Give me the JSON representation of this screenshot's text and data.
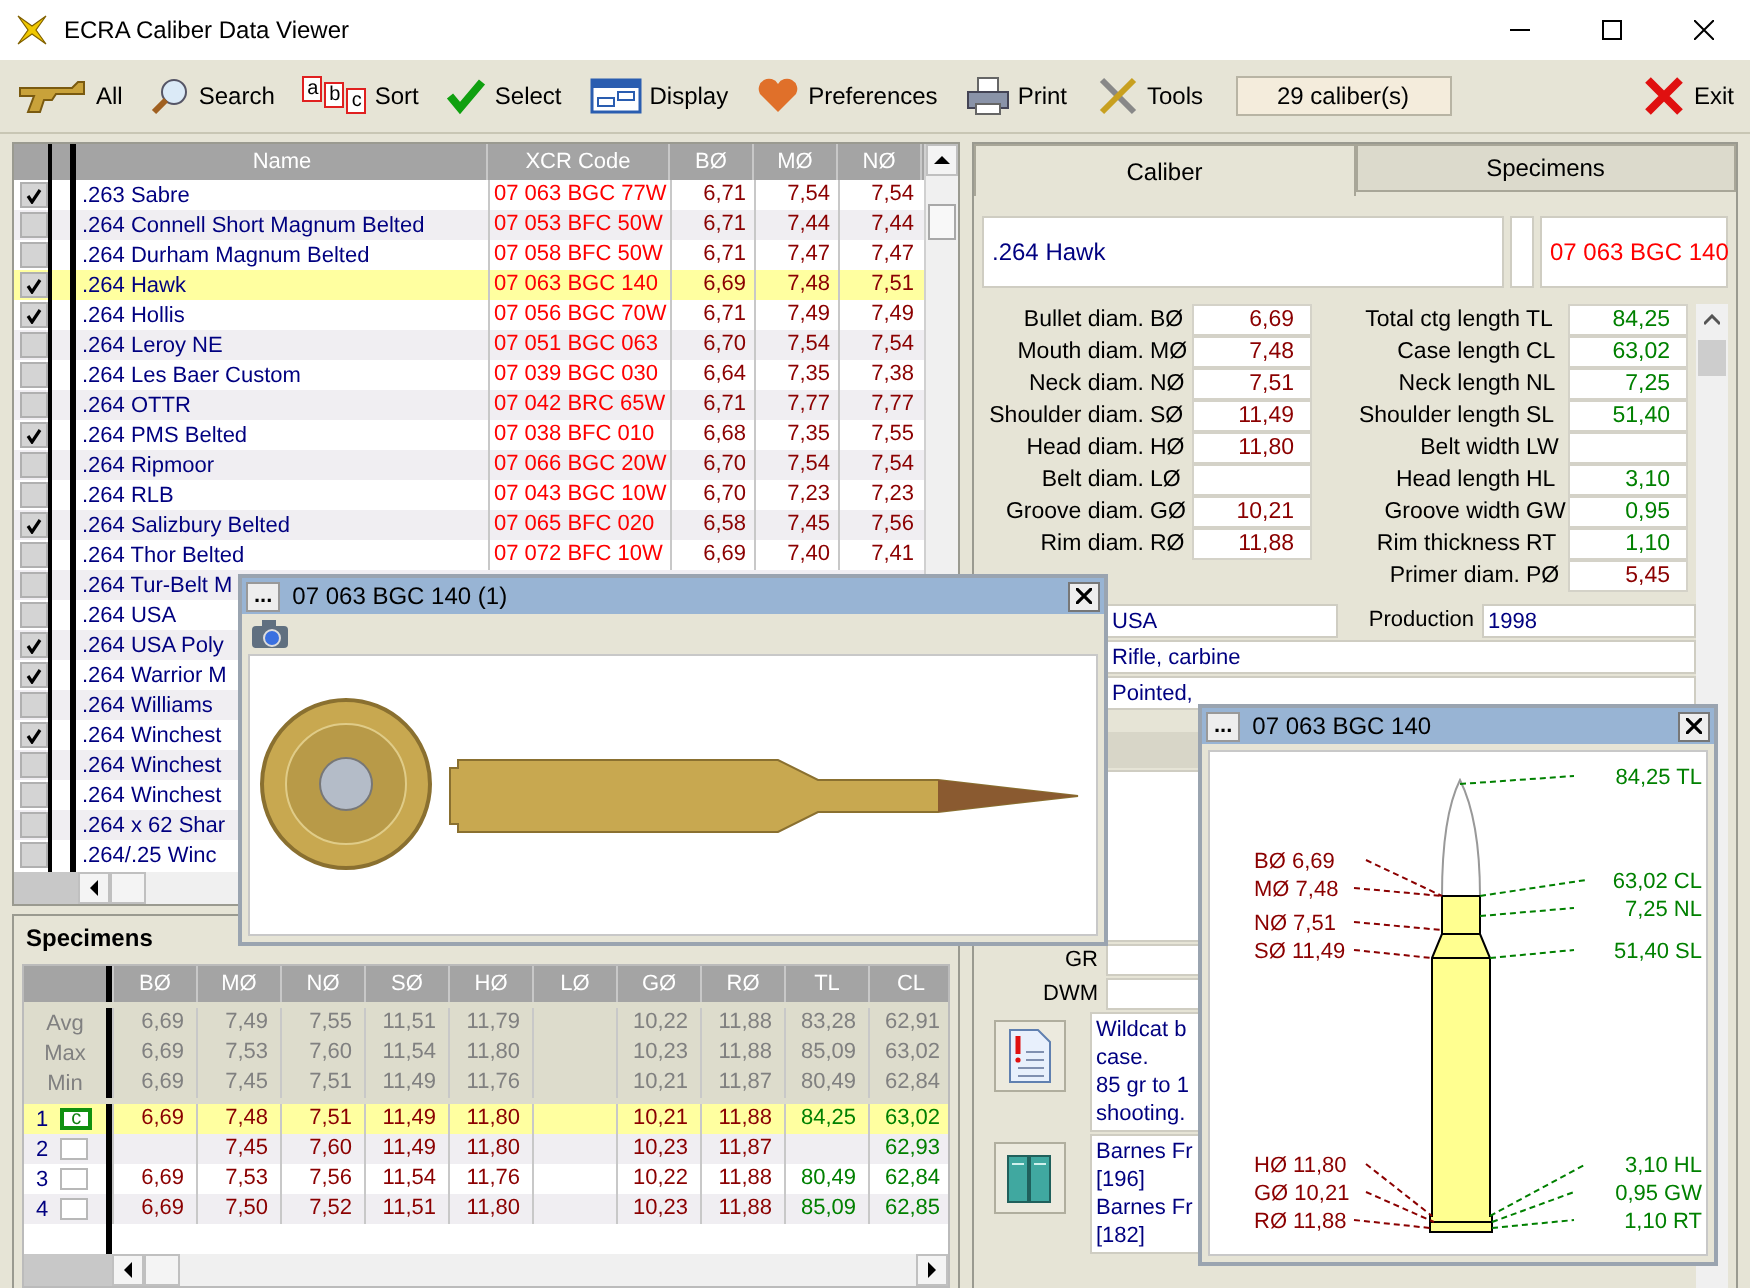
{
  "window": {
    "title": "ECRA Caliber Data Viewer"
  },
  "toolbar": {
    "buttons": [
      {
        "label": "All",
        "kind": "all"
      },
      {
        "label": "Search",
        "kind": "search"
      },
      {
        "label": "Sort",
        "kind": "sort",
        "icon_letters": [
          "a",
          "b",
          "c"
        ]
      },
      {
        "label": "Select",
        "kind": "select"
      },
      {
        "label": "Display",
        "kind": "display"
      },
      {
        "label": "Preferences",
        "kind": "preferences"
      },
      {
        "label": "Print",
        "kind": "print"
      },
      {
        "label": "Tools",
        "kind": "tools"
      }
    ],
    "counter": "29 caliber(s)",
    "exit_button": {
      "label": "Exit"
    }
  },
  "caliber_table": {
    "columns": [
      "Name",
      "XCR Code",
      "BØ",
      "MØ",
      "NØ"
    ],
    "rows": [
      {
        "checked": true,
        "selected": false,
        "cells": [
          ".263 Sabre",
          "07 063 BGC 77W",
          "6,71",
          "7,54",
          "7,54"
        ]
      },
      {
        "checked": false,
        "selected": false,
        "cells": [
          ".264 Connell Short Magnum Belted",
          "07 053 BFC 50W",
          "6,71",
          "7,44",
          "7,44"
        ]
      },
      {
        "checked": false,
        "selected": false,
        "cells": [
          ".264 Durham Magnum Belted",
          "07 058 BFC 50W",
          "6,71",
          "7,47",
          "7,47"
        ]
      },
      {
        "checked": true,
        "selected": true,
        "cells": [
          ".264 Hawk",
          "07 063 BGC 140",
          "6,69",
          "7,48",
          "7,51"
        ]
      },
      {
        "checked": true,
        "selected": false,
        "cells": [
          ".264 Hollis",
          "07 056 BGC 70W",
          "6,71",
          "7,49",
          "7,49"
        ]
      },
      {
        "checked": false,
        "selected": false,
        "cells": [
          ".264 Leroy NE",
          "07 051 BGC 063",
          "6,70",
          "7,54",
          "7,54"
        ]
      },
      {
        "checked": false,
        "selected": false,
        "cells": [
          ".264 Les Baer Custom",
          "07 039 BGC 030",
          "6,64",
          "7,35",
          "7,38"
        ]
      },
      {
        "checked": false,
        "selected": false,
        "cells": [
          ".264 OTTR",
          "07 042 BRC 65W",
          "6,71",
          "7,77",
          "7,77"
        ]
      },
      {
        "checked": true,
        "selected": false,
        "cells": [
          ".264 PMS Belted",
          "07 038 BFC 010",
          "6,68",
          "7,35",
          "7,55"
        ]
      },
      {
        "checked": false,
        "selected": false,
        "cells": [
          ".264 Ripmoor",
          "07 066 BGC 20W",
          "6,70",
          "7,54",
          "7,54"
        ]
      },
      {
        "checked": false,
        "selected": false,
        "cells": [
          ".264 RLB",
          "07 043 BGC 10W",
          "6,70",
          "7,23",
          "7,23"
        ]
      },
      {
        "checked": true,
        "selected": false,
        "cells": [
          ".264 Salizbury Belted",
          "07 065 BFC 020",
          "6,58",
          "7,45",
          "7,56"
        ]
      },
      {
        "checked": false,
        "selected": false,
        "cells": [
          ".264 Thor Belted",
          "07 072 BFC 10W",
          "6,69",
          "7,40",
          "7,41"
        ]
      },
      {
        "checked": false,
        "selected": false,
        "cells": [
          ".264 Tur-Belt M"
        ]
      },
      {
        "checked": false,
        "selected": false,
        "cells": [
          ".264 USA"
        ]
      },
      {
        "checked": true,
        "selected": false,
        "cells": [
          ".264 USA Poly"
        ]
      },
      {
        "checked": true,
        "selected": false,
        "cells": [
          ".264 Warrior M"
        ]
      },
      {
        "checked": false,
        "selected": false,
        "cells": [
          ".264 Williams"
        ]
      },
      {
        "checked": true,
        "selected": false,
        "cells": [
          ".264 Winchest"
        ]
      },
      {
        "checked": false,
        "selected": false,
        "cells": [
          ".264 Winchest"
        ]
      },
      {
        "checked": false,
        "selected": false,
        "cells": [
          ".264 Winchest"
        ]
      },
      {
        "checked": false,
        "selected": false,
        "cells": [
          ".264 x 62 Shar"
        ]
      },
      {
        "checked": false,
        "selected": false,
        "cells": [
          ".264/.25 Winc"
        ]
      }
    ]
  },
  "specimens": {
    "title": "Specimens",
    "columns": [
      {
        "label": "BØ",
        "kind": "diameter"
      },
      {
        "label": "MØ",
        "kind": "diameter"
      },
      {
        "label": "NØ",
        "kind": "diameter"
      },
      {
        "label": "SØ",
        "kind": "diameter"
      },
      {
        "label": "HØ",
        "kind": "diameter"
      },
      {
        "label": "LØ",
        "kind": "diameter"
      },
      {
        "label": "GØ",
        "kind": "diameter"
      },
      {
        "label": "RØ",
        "kind": "diameter"
      },
      {
        "label": "TL",
        "kind": "length"
      },
      {
        "label": "CL",
        "kind": "length"
      }
    ],
    "summary_rows": [
      {
        "label": "Avg",
        "values": [
          "6,69",
          "7,49",
          "7,55",
          "11,51",
          "11,79",
          {
            "kind": "empty"
          },
          "10,22",
          "11,88",
          "83,28",
          "62,91"
        ]
      },
      {
        "label": "Max",
        "values": [
          "6,69",
          "7,53",
          "7,60",
          "11,54",
          "11,80",
          {
            "kind": "empty"
          },
          "10,23",
          "11,88",
          "85,09",
          "63,02"
        ]
      },
      {
        "label": "Min",
        "values": [
          "6,69",
          "7,45",
          "7,51",
          "11,49",
          "11,76",
          {
            "kind": "empty"
          },
          "10,21",
          "11,87",
          "80,49",
          "62,84"
        ]
      }
    ],
    "rows": [
      {
        "number": "1",
        "marker": "c",
        "selected": true,
        "values": [
          "6,69",
          "7,48",
          "7,51",
          "11,49",
          "11,80",
          {
            "kind": "empty"
          },
          "10,21",
          "11,88",
          "84,25",
          "63,02"
        ]
      },
      {
        "number": "2",
        "selected": false,
        "values": [
          {
            "kind": "empty"
          },
          "7,45",
          "7,60",
          "11,49",
          "11,80",
          {
            "kind": "empty"
          },
          "10,23",
          "11,87",
          {
            "kind": "empty"
          },
          "62,93"
        ]
      },
      {
        "number": "3",
        "selected": false,
        "values": [
          "6,69",
          "7,53",
          "7,56",
          "11,54",
          "11,76",
          {
            "kind": "empty"
          },
          "10,22",
          "11,88",
          "80,49",
          "62,84"
        ]
      },
      {
        "number": "4",
        "selected": false,
        "values": [
          "6,69",
          "7,50",
          "7,52",
          "11,51",
          "11,80",
          {
            "kind": "empty"
          },
          "10,23",
          "11,88",
          "85,09",
          "62,85"
        ]
      }
    ]
  },
  "detail": {
    "tabs": [
      {
        "label": "Caliber",
        "selected": true
      },
      {
        "label": "Specimens",
        "selected": false
      }
    ],
    "name": ".264 Hawk",
    "code": "07 063 BGC 140",
    "diameters": [
      {
        "label": "Bullet diam.",
        "abbr": "BØ",
        "value": "6,69",
        "kind": "diameter"
      },
      {
        "label": "Mouth diam.",
        "abbr": "MØ",
        "value": "7,48",
        "kind": "diameter"
      },
      {
        "label": "Neck diam.",
        "abbr": "NØ",
        "value": "7,51",
        "kind": "diameter"
      },
      {
        "label": "Shoulder diam.",
        "abbr": "SØ",
        "value": "11,49",
        "kind": "diameter"
      },
      {
        "label": "Head diam.",
        "abbr": "HØ",
        "value": "11,80",
        "kind": "diameter"
      },
      {
        "label": "Belt diam.",
        "abbr": "LØ",
        "kind": "diameter"
      },
      {
        "label": "Groove diam.",
        "abbr": "GØ",
        "value": "10,21",
        "kind": "diameter"
      },
      {
        "label": "Rim diam.",
        "abbr": "RØ",
        "value": "11,88",
        "kind": "diameter"
      }
    ],
    "lengths": [
      {
        "label": "Total ctg length",
        "abbr": "TL",
        "value": "84,25",
        "kind": "length"
      },
      {
        "label": "Case length",
        "abbr": "CL",
        "value": "63,02",
        "kind": "length"
      },
      {
        "label": "Neck length",
        "abbr": "NL",
        "value": "7,25",
        "kind": "length"
      },
      {
        "label": "Shoulder length",
        "abbr": "SL",
        "value": "51,40",
        "kind": "length"
      },
      {
        "label": "Belt width",
        "abbr": "LW",
        "kind": "length"
      },
      {
        "label": "Head length",
        "abbr": "HL",
        "value": "3,10",
        "kind": "length"
      },
      {
        "label": "Groove width",
        "abbr": "GW",
        "value": "0,95",
        "kind": "length"
      },
      {
        "label": "Rim thickness",
        "abbr": "RT",
        "value": "1,10",
        "kind": "length"
      },
      {
        "label": "Primer diam.",
        "abbr": "PØ",
        "value": "5,45",
        "kind": "diameter"
      }
    ],
    "country": "USA",
    "production_label": "Production",
    "production_year": "1998",
    "usage": "Rifle, carbine",
    "bullet": "Pointed,",
    "gr_label": "GR",
    "dwm_label": "DWM",
    "notes": [
      "Wildcat b",
      "case.",
      "85 gr to 1",
      "shooting."
    ],
    "references": [
      "Barnes Fr",
      "[196]",
      "Barnes Fr",
      "[182]"
    ]
  },
  "photo_window": {
    "menu_label": "...",
    "title": "07 063 BGC 140  (1)"
  },
  "diagram_window": {
    "menu_label": "...",
    "title": "07 063 BGC 140",
    "left_labels": [
      "BØ 6,69",
      "MØ 7,48",
      "NØ 7,51",
      "SØ 11,49",
      "HØ 11,80",
      "GØ 10,21",
      "RØ 11,88"
    ],
    "right_labels": [
      "84,25 TL",
      "63,02 CL",
      "7,25 NL",
      "51,40 SL",
      "3,10 HL",
      "0,95 GW",
      "1,10 RT"
    ]
  }
}
